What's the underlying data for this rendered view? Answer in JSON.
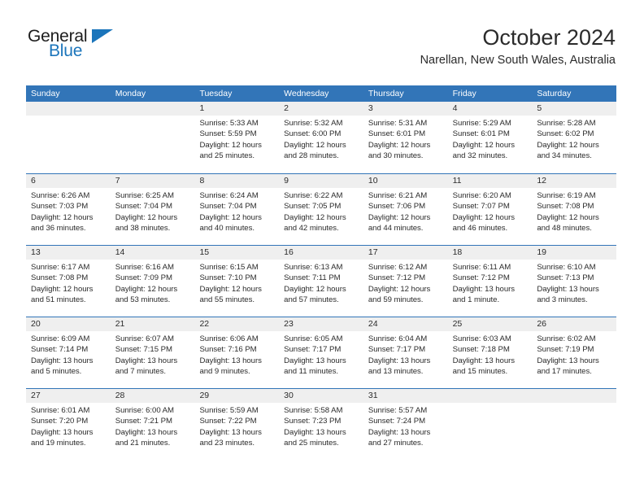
{
  "brand": {
    "name_top": "General",
    "name_bottom": "Blue",
    "accent_color": "#1b75bb",
    "logo_icon": "triangle-flag-icon"
  },
  "header": {
    "title": "October 2024",
    "subtitle": "Narellan, New South Wales, Australia"
  },
  "calendar": {
    "header_color": "#3275b8",
    "date_strip_color": "#efefef",
    "weekdays": [
      "Sunday",
      "Monday",
      "Tuesday",
      "Wednesday",
      "Thursday",
      "Friday",
      "Saturday"
    ],
    "weeks": [
      [
        {
          "date": "",
          "lines": []
        },
        {
          "date": "",
          "lines": []
        },
        {
          "date": "1",
          "lines": [
            "Sunrise: 5:33 AM",
            "Sunset: 5:59 PM",
            "Daylight: 12 hours",
            "and 25 minutes."
          ]
        },
        {
          "date": "2",
          "lines": [
            "Sunrise: 5:32 AM",
            "Sunset: 6:00 PM",
            "Daylight: 12 hours",
            "and 28 minutes."
          ]
        },
        {
          "date": "3",
          "lines": [
            "Sunrise: 5:31 AM",
            "Sunset: 6:01 PM",
            "Daylight: 12 hours",
            "and 30 minutes."
          ]
        },
        {
          "date": "4",
          "lines": [
            "Sunrise: 5:29 AM",
            "Sunset: 6:01 PM",
            "Daylight: 12 hours",
            "and 32 minutes."
          ]
        },
        {
          "date": "5",
          "lines": [
            "Sunrise: 5:28 AM",
            "Sunset: 6:02 PM",
            "Daylight: 12 hours",
            "and 34 minutes."
          ]
        }
      ],
      [
        {
          "date": "6",
          "lines": [
            "Sunrise: 6:26 AM",
            "Sunset: 7:03 PM",
            "Daylight: 12 hours",
            "and 36 minutes."
          ]
        },
        {
          "date": "7",
          "lines": [
            "Sunrise: 6:25 AM",
            "Sunset: 7:04 PM",
            "Daylight: 12 hours",
            "and 38 minutes."
          ]
        },
        {
          "date": "8",
          "lines": [
            "Sunrise: 6:24 AM",
            "Sunset: 7:04 PM",
            "Daylight: 12 hours",
            "and 40 minutes."
          ]
        },
        {
          "date": "9",
          "lines": [
            "Sunrise: 6:22 AM",
            "Sunset: 7:05 PM",
            "Daylight: 12 hours",
            "and 42 minutes."
          ]
        },
        {
          "date": "10",
          "lines": [
            "Sunrise: 6:21 AM",
            "Sunset: 7:06 PM",
            "Daylight: 12 hours",
            "and 44 minutes."
          ]
        },
        {
          "date": "11",
          "lines": [
            "Sunrise: 6:20 AM",
            "Sunset: 7:07 PM",
            "Daylight: 12 hours",
            "and 46 minutes."
          ]
        },
        {
          "date": "12",
          "lines": [
            "Sunrise: 6:19 AM",
            "Sunset: 7:08 PM",
            "Daylight: 12 hours",
            "and 48 minutes."
          ]
        }
      ],
      [
        {
          "date": "13",
          "lines": [
            "Sunrise: 6:17 AM",
            "Sunset: 7:08 PM",
            "Daylight: 12 hours",
            "and 51 minutes."
          ]
        },
        {
          "date": "14",
          "lines": [
            "Sunrise: 6:16 AM",
            "Sunset: 7:09 PM",
            "Daylight: 12 hours",
            "and 53 minutes."
          ]
        },
        {
          "date": "15",
          "lines": [
            "Sunrise: 6:15 AM",
            "Sunset: 7:10 PM",
            "Daylight: 12 hours",
            "and 55 minutes."
          ]
        },
        {
          "date": "16",
          "lines": [
            "Sunrise: 6:13 AM",
            "Sunset: 7:11 PM",
            "Daylight: 12 hours",
            "and 57 minutes."
          ]
        },
        {
          "date": "17",
          "lines": [
            "Sunrise: 6:12 AM",
            "Sunset: 7:12 PM",
            "Daylight: 12 hours",
            "and 59 minutes."
          ]
        },
        {
          "date": "18",
          "lines": [
            "Sunrise: 6:11 AM",
            "Sunset: 7:12 PM",
            "Daylight: 13 hours",
            "and 1 minute."
          ]
        },
        {
          "date": "19",
          "lines": [
            "Sunrise: 6:10 AM",
            "Sunset: 7:13 PM",
            "Daylight: 13 hours",
            "and 3 minutes."
          ]
        }
      ],
      [
        {
          "date": "20",
          "lines": [
            "Sunrise: 6:09 AM",
            "Sunset: 7:14 PM",
            "Daylight: 13 hours",
            "and 5 minutes."
          ]
        },
        {
          "date": "21",
          "lines": [
            "Sunrise: 6:07 AM",
            "Sunset: 7:15 PM",
            "Daylight: 13 hours",
            "and 7 minutes."
          ]
        },
        {
          "date": "22",
          "lines": [
            "Sunrise: 6:06 AM",
            "Sunset: 7:16 PM",
            "Daylight: 13 hours",
            "and 9 minutes."
          ]
        },
        {
          "date": "23",
          "lines": [
            "Sunrise: 6:05 AM",
            "Sunset: 7:17 PM",
            "Daylight: 13 hours",
            "and 11 minutes."
          ]
        },
        {
          "date": "24",
          "lines": [
            "Sunrise: 6:04 AM",
            "Sunset: 7:17 PM",
            "Daylight: 13 hours",
            "and 13 minutes."
          ]
        },
        {
          "date": "25",
          "lines": [
            "Sunrise: 6:03 AM",
            "Sunset: 7:18 PM",
            "Daylight: 13 hours",
            "and 15 minutes."
          ]
        },
        {
          "date": "26",
          "lines": [
            "Sunrise: 6:02 AM",
            "Sunset: 7:19 PM",
            "Daylight: 13 hours",
            "and 17 minutes."
          ]
        }
      ],
      [
        {
          "date": "27",
          "lines": [
            "Sunrise: 6:01 AM",
            "Sunset: 7:20 PM",
            "Daylight: 13 hours",
            "and 19 minutes."
          ]
        },
        {
          "date": "28",
          "lines": [
            "Sunrise: 6:00 AM",
            "Sunset: 7:21 PM",
            "Daylight: 13 hours",
            "and 21 minutes."
          ]
        },
        {
          "date": "29",
          "lines": [
            "Sunrise: 5:59 AM",
            "Sunset: 7:22 PM",
            "Daylight: 13 hours",
            "and 23 minutes."
          ]
        },
        {
          "date": "30",
          "lines": [
            "Sunrise: 5:58 AM",
            "Sunset: 7:23 PM",
            "Daylight: 13 hours",
            "and 25 minutes."
          ]
        },
        {
          "date": "31",
          "lines": [
            "Sunrise: 5:57 AM",
            "Sunset: 7:24 PM",
            "Daylight: 13 hours",
            "and 27 minutes."
          ]
        },
        {
          "date": "",
          "lines": []
        },
        {
          "date": "",
          "lines": []
        }
      ]
    ]
  }
}
